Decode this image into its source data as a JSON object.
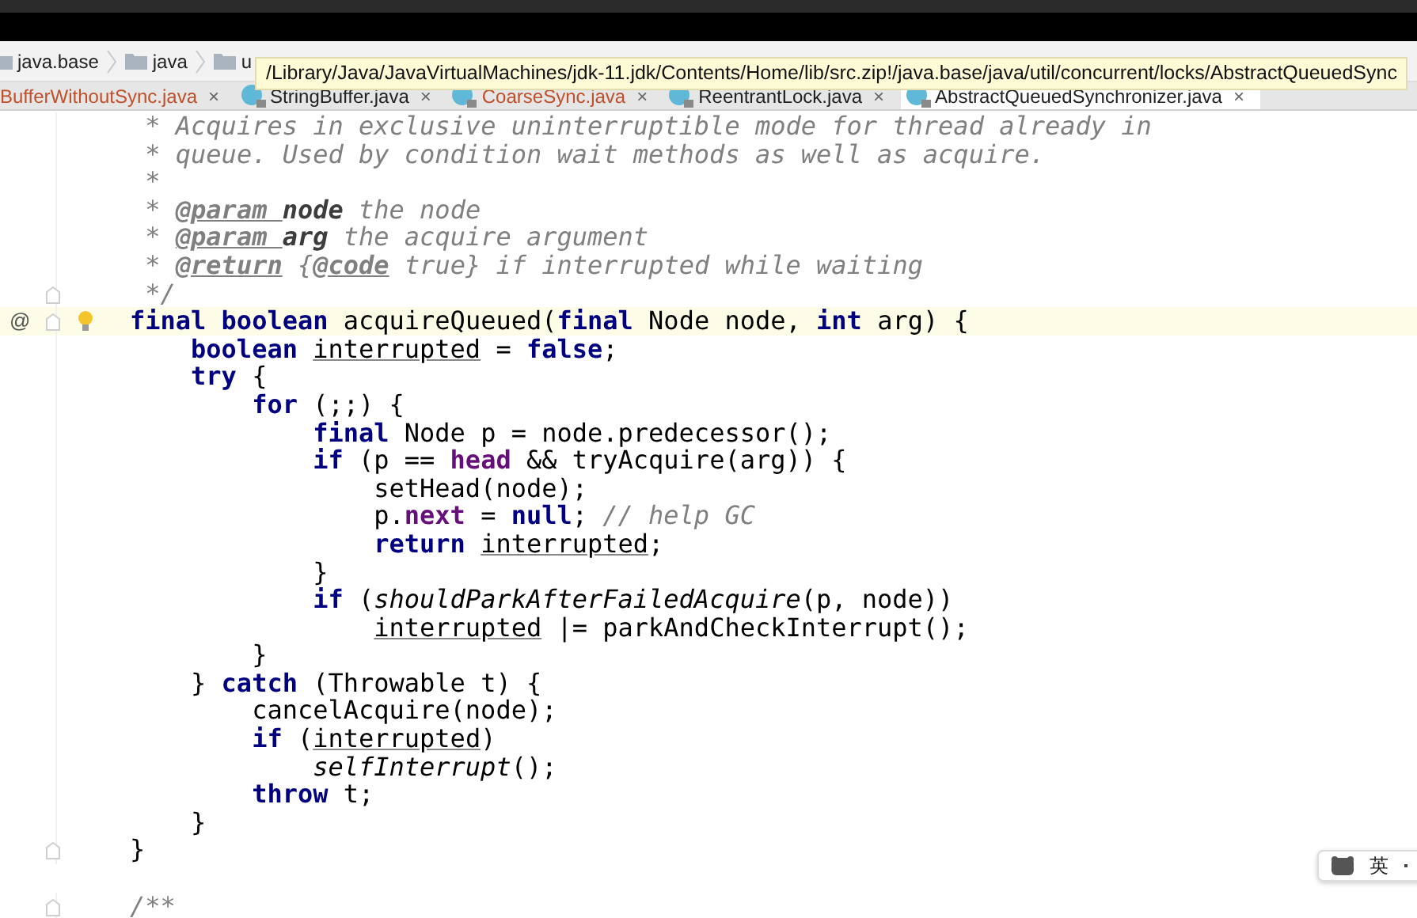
{
  "breadcrumbs": [
    "java.base",
    "java",
    "u"
  ],
  "tooltip": "/Library/Java/JavaVirtualMachines/jdk-11.jdk/Contents/Home/lib/src.zip!/java.base/java/util/concurrent/locks/AbstractQueuedSync",
  "tabs": [
    {
      "label": "BufferWithoutSync.java",
      "close": "×",
      "selected": false,
      "modified": true,
      "icon": false
    },
    {
      "label": "StringBuffer.java",
      "close": "×",
      "selected": false,
      "modified": false,
      "icon": true
    },
    {
      "label": "CoarseSync.java",
      "close": "×",
      "selected": false,
      "modified": true,
      "icon": true
    },
    {
      "label": "ReentrantLock.java",
      "close": "×",
      "selected": false,
      "modified": false,
      "icon": true
    },
    {
      "label": "AbstractQueuedSynchronizer.java",
      "close": "×",
      "selected": true,
      "modified": false,
      "icon": true
    }
  ],
  "lines": [
    {
      "segs": [
        {
          "kind": "comment",
          "text": " * Acquires in exclusive uninterruptible mode for thread already in"
        }
      ]
    },
    {
      "segs": [
        {
          "kind": "comment",
          "text": " * queue. Used by condition wait methods as well as acquire."
        }
      ]
    },
    {
      "segs": [
        {
          "kind": "comment",
          "text": " *"
        }
      ]
    },
    {
      "segs": [
        {
          "kind": "comment",
          "text": " * "
        },
        {
          "kind": "tag",
          "text": "@param "
        },
        {
          "kind": "param",
          "text": "node"
        },
        {
          "kind": "comment",
          "text": " the node"
        }
      ]
    },
    {
      "segs": [
        {
          "kind": "comment",
          "text": " * "
        },
        {
          "kind": "tag",
          "text": "@param "
        },
        {
          "kind": "param",
          "text": "arg"
        },
        {
          "kind": "comment",
          "text": " the acquire argument"
        }
      ]
    },
    {
      "segs": [
        {
          "kind": "comment",
          "text": " * "
        },
        {
          "kind": "tag",
          "text": "@return"
        },
        {
          "kind": "comment",
          "text": " {"
        },
        {
          "kind": "tag",
          "text": "@code"
        },
        {
          "kind": "comment",
          "text": " true} if interrupted while waiting"
        }
      ]
    },
    {
      "fold": true,
      "segs": [
        {
          "kind": "comment",
          "text": " */"
        }
      ]
    },
    {
      "fold": true,
      "current": true,
      "marker": "@",
      "bulb": true,
      "segs": [
        {
          "kind": "kw",
          "text": "final boolean"
        },
        {
          "kind": "plain",
          "text": " acquireQueued("
        },
        {
          "kind": "kw",
          "text": "final"
        },
        {
          "kind": "plain",
          "text": " Node node, "
        },
        {
          "kind": "kw",
          "text": "int"
        },
        {
          "kind": "plain",
          "text": " arg) {"
        }
      ]
    },
    {
      "segs": [
        {
          "kind": "kw",
          "text": "    boolean "
        },
        {
          "kind": "local",
          "text": "interrupted"
        },
        {
          "kind": "plain",
          "text": " = "
        },
        {
          "kind": "kw",
          "text": "false"
        },
        {
          "kind": "plain",
          "text": ";"
        }
      ]
    },
    {
      "segs": [
        {
          "kind": "kw",
          "text": "    try"
        },
        {
          "kind": "plain",
          "text": " {"
        }
      ]
    },
    {
      "segs": [
        {
          "kind": "kw",
          "text": "        for"
        },
        {
          "kind": "plain",
          "text": " (;;) {"
        }
      ]
    },
    {
      "segs": [
        {
          "kind": "kw",
          "text": "            final"
        },
        {
          "kind": "plain",
          "text": " Node p = node.predecessor();"
        }
      ]
    },
    {
      "segs": [
        {
          "kind": "kw",
          "text": "            if"
        },
        {
          "kind": "plain",
          "text": " (p == "
        },
        {
          "kind": "field",
          "text": "head"
        },
        {
          "kind": "plain",
          "text": " && tryAcquire(arg)) {"
        }
      ]
    },
    {
      "segs": [
        {
          "kind": "plain",
          "text": "                setHead(node);"
        }
      ]
    },
    {
      "segs": [
        {
          "kind": "plain",
          "text": "                p."
        },
        {
          "kind": "field",
          "text": "next"
        },
        {
          "kind": "plain",
          "text": " = "
        },
        {
          "kind": "kw",
          "text": "null"
        },
        {
          "kind": "plain",
          "text": "; "
        },
        {
          "kind": "comment",
          "text": "// help GC"
        }
      ]
    },
    {
      "segs": [
        {
          "kind": "kw",
          "text": "                return "
        },
        {
          "kind": "local",
          "text": "interrupted"
        },
        {
          "kind": "plain",
          "text": ";"
        }
      ]
    },
    {
      "segs": [
        {
          "kind": "plain",
          "text": "            }"
        }
      ]
    },
    {
      "segs": [
        {
          "kind": "kw",
          "text": "            if"
        },
        {
          "kind": "plain",
          "text": " ("
        },
        {
          "kind": "static",
          "text": "shouldParkAfterFailedAcquire"
        },
        {
          "kind": "plain",
          "text": "(p, node))"
        }
      ]
    },
    {
      "segs": [
        {
          "kind": "local",
          "text": "                interrupted"
        },
        {
          "kind": "plain",
          "text": " |= parkAndCheckInterrupt();"
        }
      ]
    },
    {
      "segs": [
        {
          "kind": "plain",
          "text": "        }"
        }
      ]
    },
    {
      "segs": [
        {
          "kind": "plain",
          "text": "    } "
        },
        {
          "kind": "kw",
          "text": "catch"
        },
        {
          "kind": "plain",
          "text": " (Throwable t) {"
        }
      ]
    },
    {
      "segs": [
        {
          "kind": "plain",
          "text": "        cancelAcquire(node);"
        }
      ]
    },
    {
      "segs": [
        {
          "kind": "kw",
          "text": "        if"
        },
        {
          "kind": "plain",
          "text": " ("
        },
        {
          "kind": "local",
          "text": "interrupted"
        },
        {
          "kind": "plain",
          "text": ")"
        }
      ]
    },
    {
      "segs": [
        {
          "kind": "static",
          "text": "            selfInterrupt"
        },
        {
          "kind": "plain",
          "text": "();"
        }
      ]
    },
    {
      "segs": [
        {
          "kind": "kw",
          "text": "        throw"
        },
        {
          "kind": "plain",
          "text": " t;"
        }
      ]
    },
    {
      "segs": [
        {
          "kind": "plain",
          "text": "    }"
        }
      ]
    },
    {
      "fold": true,
      "segs": [
        {
          "kind": "plain",
          "text": "}"
        }
      ]
    },
    {
      "fold": true,
      "gap_before": true,
      "segs": [
        {
          "kind": "comment",
          "text": "/**"
        }
      ]
    }
  ],
  "ime": {
    "label": "英"
  }
}
